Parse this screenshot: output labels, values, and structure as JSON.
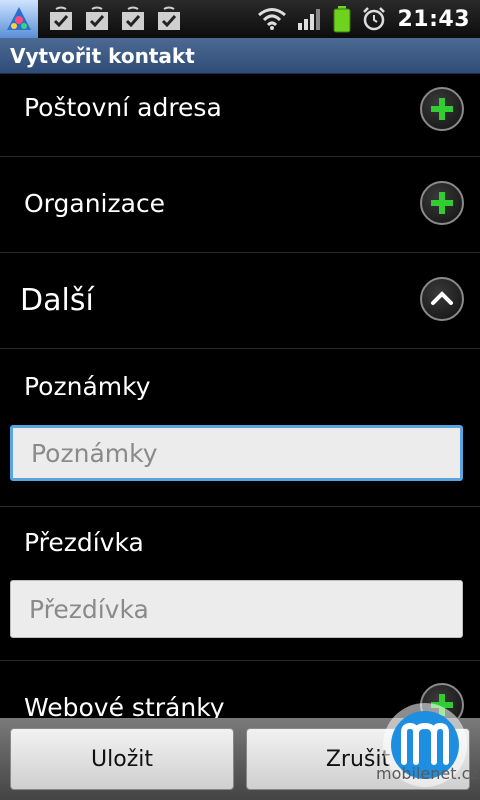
{
  "status_bar": {
    "time": "21:43",
    "icons": [
      "app-icon",
      "notification-check-icon",
      "notification-check-icon",
      "notification-check-icon",
      "notification-check-icon",
      "wifi-icon",
      "signal-icon",
      "battery-icon",
      "alarm-icon"
    ]
  },
  "title_bar": {
    "title": "Vytvořit kontakt"
  },
  "rows": {
    "postal": {
      "label": "Poštovní adresa",
      "icon": "add-icon"
    },
    "organization": {
      "label": "Organizace",
      "icon": "add-icon"
    },
    "more": {
      "label": "Další",
      "icon": "chevron-up-icon"
    },
    "website": {
      "label": "Webové stránky",
      "icon": "add-icon"
    }
  },
  "notes": {
    "label": "Poznámky",
    "placeholder": "Poznámky"
  },
  "nickname": {
    "label": "Přezdívka",
    "placeholder": "Přezdívka"
  },
  "buttons": {
    "save": "Uložit",
    "cancel": "Zrušit"
  },
  "watermark": {
    "text": "mobilenet.cz"
  },
  "colors": {
    "accent": "#58a5e0",
    "add_green": "#33cc33",
    "title_bar": "#3d5b86"
  }
}
